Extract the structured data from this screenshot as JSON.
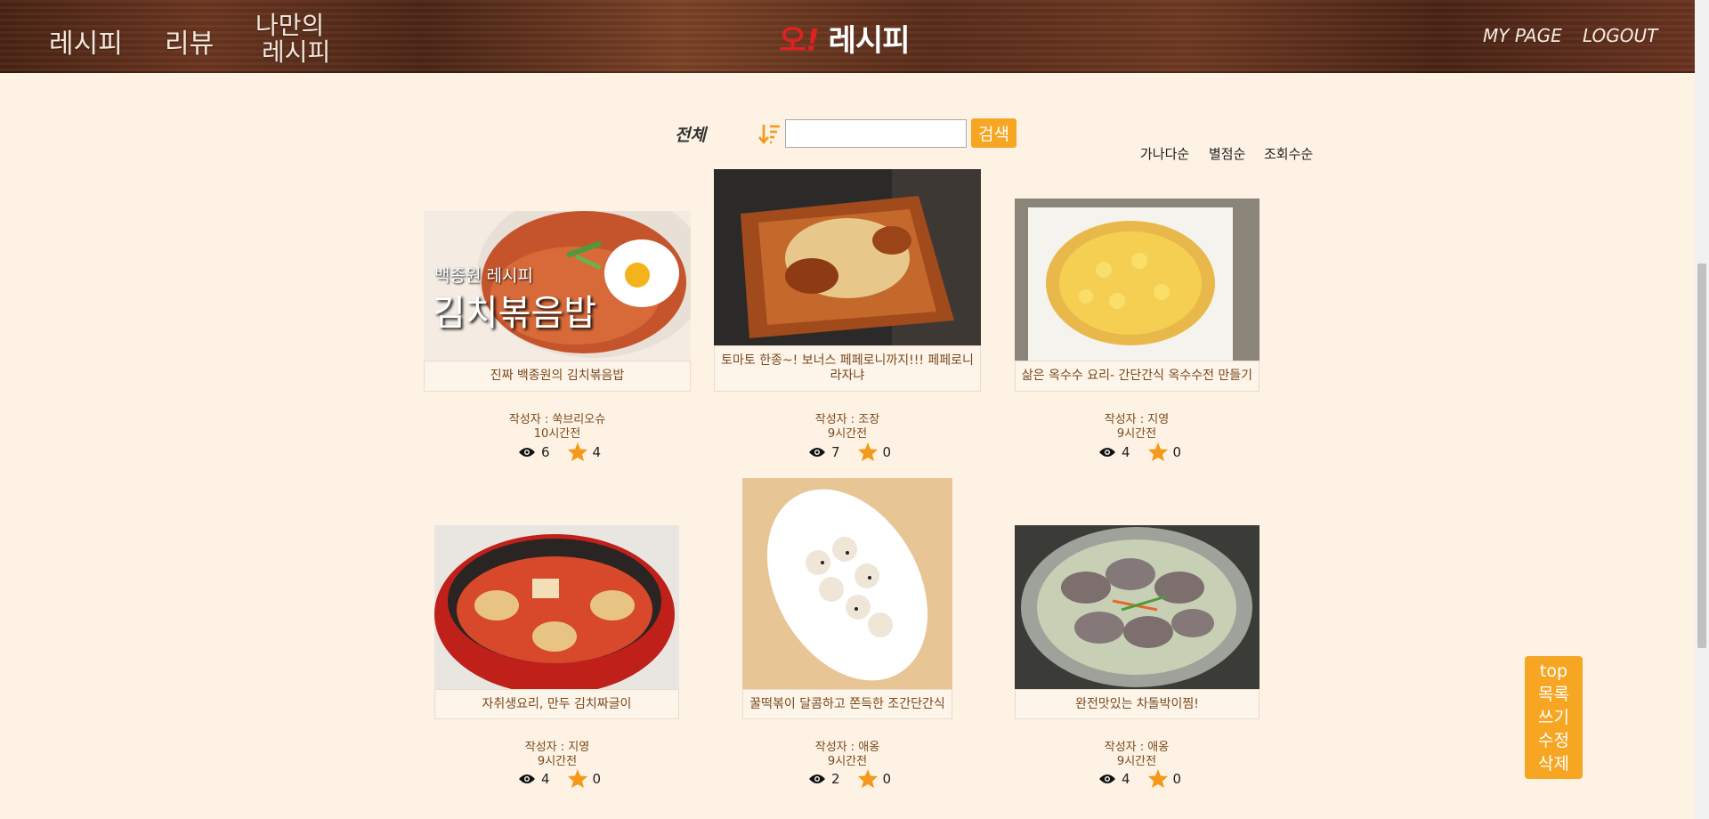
{
  "header": {
    "nav": {
      "recipe": "레시피",
      "review": "리뷰",
      "my_recipe_line1": "나만의",
      "my_recipe_line2": "레시피"
    },
    "logo": {
      "o": "오",
      "ex": "!",
      "rest": "레시피"
    },
    "right": {
      "mypage": "MY PAGE",
      "logout": "LOGOUT"
    }
  },
  "search": {
    "filter_label": "전체",
    "sort_icon": "sort-desc-icon",
    "input_value": "",
    "button_label": "검색"
  },
  "sort_options": [
    "가나다순",
    "별점순",
    "조회수순"
  ],
  "colors": {
    "accent": "#f6a623",
    "background": "#fdf2e4",
    "text_brown": "#7a4a1c"
  },
  "recipes": [
    {
      "title": "진짜 백종원의 김치볶음밥",
      "image_caption_line1": "백종원 레시피",
      "image_caption_line2": "김치볶음밥",
      "author": "작성자 : 쑥브리오슈",
      "time": "10시간전",
      "views": "6",
      "stars": "4"
    },
    {
      "title": "토마토 한종~! 보너스 페페로니까지!!! 페페로니라자냐",
      "author": "작성자 : 조장",
      "time": "9시간전",
      "views": "7",
      "stars": "0"
    },
    {
      "title": "삶은 옥수수 요리- 간단간식 옥수수전 만들기",
      "author": "작성자 : 지영",
      "time": "9시간전",
      "views": "4",
      "stars": "0"
    },
    {
      "title": "자취생요리, 만두 김치짜글이",
      "author": "작성자 : 지영",
      "time": "9시간전",
      "views": "4",
      "stars": "0"
    },
    {
      "title": "꿀떡볶이 달콤하고 쫀득한 조간단간식",
      "author": "작성자 : 애옹",
      "time": "9시간전",
      "views": "2",
      "stars": "0"
    },
    {
      "title": "완전맛있는 차돌박이찜!",
      "author": "작성자 : 애옹",
      "time": "9시간전",
      "views": "4",
      "stars": "0"
    }
  ],
  "side_panel": [
    "top",
    "목록",
    "쓰기",
    "수정",
    "삭제"
  ]
}
